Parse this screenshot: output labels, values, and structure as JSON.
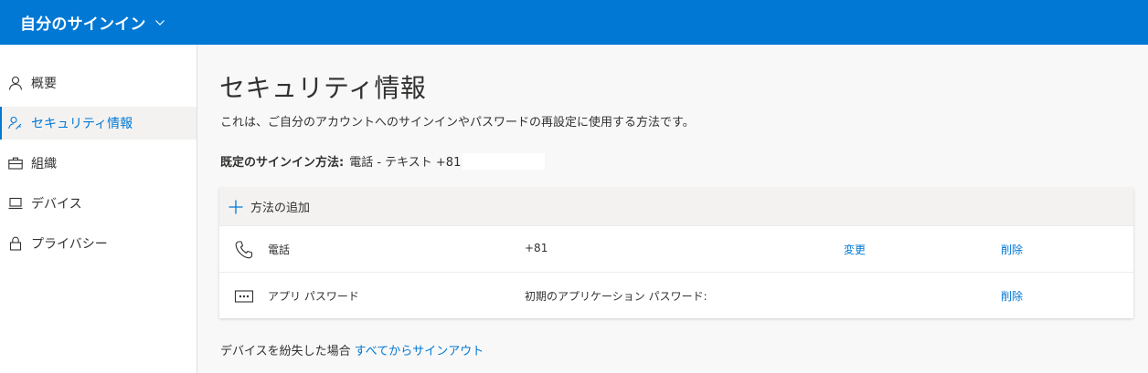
{
  "header": {
    "title": "自分のサインイン"
  },
  "sidebar": {
    "items": [
      {
        "label": "概要",
        "icon": "person-icon"
      },
      {
        "label": "セキュリティ情報",
        "icon": "person-key-icon",
        "active": true
      },
      {
        "label": "組織",
        "icon": "briefcase-icon"
      },
      {
        "label": "デバイス",
        "icon": "laptop-icon"
      },
      {
        "label": "プライバシー",
        "icon": "lock-icon"
      }
    ]
  },
  "main": {
    "title": "セキュリティ情報",
    "description": "これは、ご自分のアカウントへのサインインやパスワードの再設定に使用する方法です。",
    "default_method_label": "既定のサインイン方法:",
    "default_method_value": "電話 - テキスト +81",
    "add_method": "方法の追加",
    "methods": [
      {
        "name": "電話",
        "value": "+81",
        "change": "変更",
        "delete": "削除",
        "icon": "phone-icon"
      },
      {
        "name": "アプリ パスワード",
        "value": "初期のアプリケーション パスワード:",
        "change": "",
        "delete": "削除",
        "icon": "password-dots-icon"
      }
    ],
    "lost_device_text": "デバイスを紛失した場合",
    "sign_out_everywhere": "すべてからサインアウト"
  },
  "colors": {
    "accent": "#0078d4",
    "header_bg": "#0078d4",
    "active_bg": "#f3f2f1"
  }
}
